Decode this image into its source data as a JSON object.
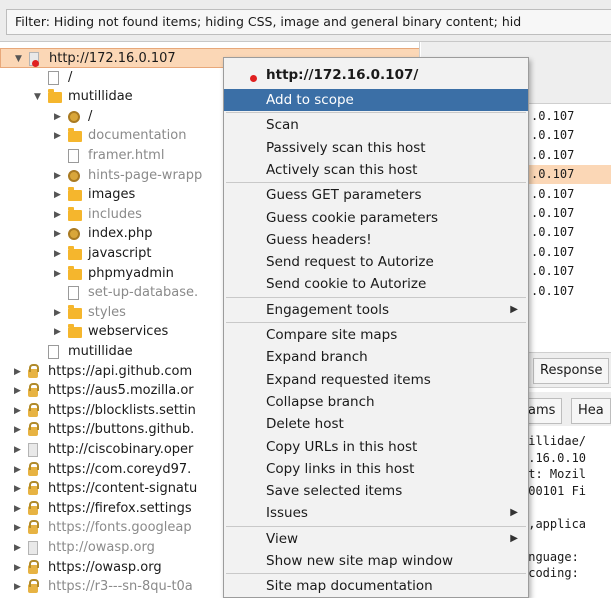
{
  "filter": {
    "text": "Filter: Hiding not found items;  hiding CSS, image and general binary content;  hid"
  },
  "tree": {
    "items": [
      {
        "label": "http://172.16.0.107",
        "icon": "host-icon",
        "selected": true
      },
      {
        "label": "/",
        "icon": "folder-doc-icon"
      },
      {
        "label": "mutillidae",
        "icon": "folder-icon"
      },
      {
        "label": "/",
        "icon": "gear-icon"
      },
      {
        "label": "documentation",
        "icon": "folder-icon",
        "dim": true
      },
      {
        "label": "framer.html",
        "icon": "document-icon",
        "dim": true
      },
      {
        "label": "hints-page-wrapp",
        "icon": "gear-icon",
        "dim": true
      },
      {
        "label": "images",
        "icon": "folder-icon"
      },
      {
        "label": "includes",
        "icon": "folder-icon",
        "dim": true
      },
      {
        "label": "index.php",
        "icon": "gear-icon"
      },
      {
        "label": "javascript",
        "icon": "folder-icon"
      },
      {
        "label": "phpmyadmin",
        "icon": "folder-icon"
      },
      {
        "label": "set-up-database.",
        "icon": "document-icon",
        "dim": true
      },
      {
        "label": "styles",
        "icon": "folder-icon",
        "dim": true
      },
      {
        "label": "webservices",
        "icon": "folder-icon"
      },
      {
        "label": "mutillidae",
        "icon": "document-icon"
      },
      {
        "label": "https://api.github.com",
        "icon": "lock-icon"
      },
      {
        "label": "https://aus5.mozilla.or",
        "icon": "lock-icon"
      },
      {
        "label": "https://blocklists.settin",
        "icon": "lock-icon"
      },
      {
        "label": "https://buttons.github.",
        "icon": "lock-icon"
      },
      {
        "label": "http://ciscobinary.oper",
        "icon": "plain-host-icon"
      },
      {
        "label": "https://com.coreyd97.",
        "icon": "lock-icon"
      },
      {
        "label": "https://content-signatu",
        "icon": "lock-icon"
      },
      {
        "label": "https://firefox.settings",
        "icon": "lock-icon"
      },
      {
        "label": "https://fonts.googleap",
        "icon": "lock-icon",
        "dim": true
      },
      {
        "label": "http://owasp.org",
        "icon": "plain-host-icon",
        "dim": true
      },
      {
        "label": "https://owasp.org",
        "icon": "lock-icon"
      },
      {
        "label": "https://r3---sn-8qu-t0a",
        "icon": "lock-icon",
        "dim": true
      }
    ]
  },
  "right": {
    "ip_rows": [
      ".0.107",
      ".0.107",
      ".0.107",
      ".0.107",
      ".0.107",
      ".0.107",
      ".0.107",
      ".0.107",
      ".0.107",
      ".0.107"
    ],
    "selected_ip_row": 3,
    "tab_response": "Response",
    "tab_params": "ams",
    "tab_headers": "Hea",
    "request_lines": [
      "tillidae/",
      "2.16.0.10",
      "nt: Mozil",
      "100101 Fi",
      "",
      "l,applica",
      "",
      "anguage:",
      "ncoding:"
    ]
  },
  "menu": {
    "header": "http://172.16.0.107/",
    "items": [
      {
        "label": "Add to scope",
        "highlighted": true
      },
      {
        "label": "Scan",
        "sep_before": true
      },
      {
        "label": "Passively scan this host"
      },
      {
        "label": "Actively scan this host"
      },
      {
        "label": "Guess GET parameters",
        "sep_before": true
      },
      {
        "label": "Guess cookie parameters"
      },
      {
        "label": "Guess headers!"
      },
      {
        "label": "Send request to Autorize"
      },
      {
        "label": "Send cookie to Autorize"
      },
      {
        "label": "Engagement tools",
        "submenu": true,
        "sep_before": true
      },
      {
        "label": "Compare site maps",
        "sep_before": true
      },
      {
        "label": "Expand branch"
      },
      {
        "label": "Expand requested items"
      },
      {
        "label": "Collapse branch"
      },
      {
        "label": "Delete host"
      },
      {
        "label": "Copy URLs in this host"
      },
      {
        "label": "Copy links in this host"
      },
      {
        "label": "Save selected items"
      },
      {
        "label": "Issues",
        "submenu": true
      },
      {
        "label": "View",
        "submenu": true,
        "sep_before": true
      },
      {
        "label": "Show new site map window"
      },
      {
        "label": "Site map documentation",
        "sep_before": true
      }
    ]
  },
  "colors": {
    "menu_highlight": "#3b6fa6",
    "selection": "#fbd7b6",
    "folder": "#f5b62d"
  }
}
